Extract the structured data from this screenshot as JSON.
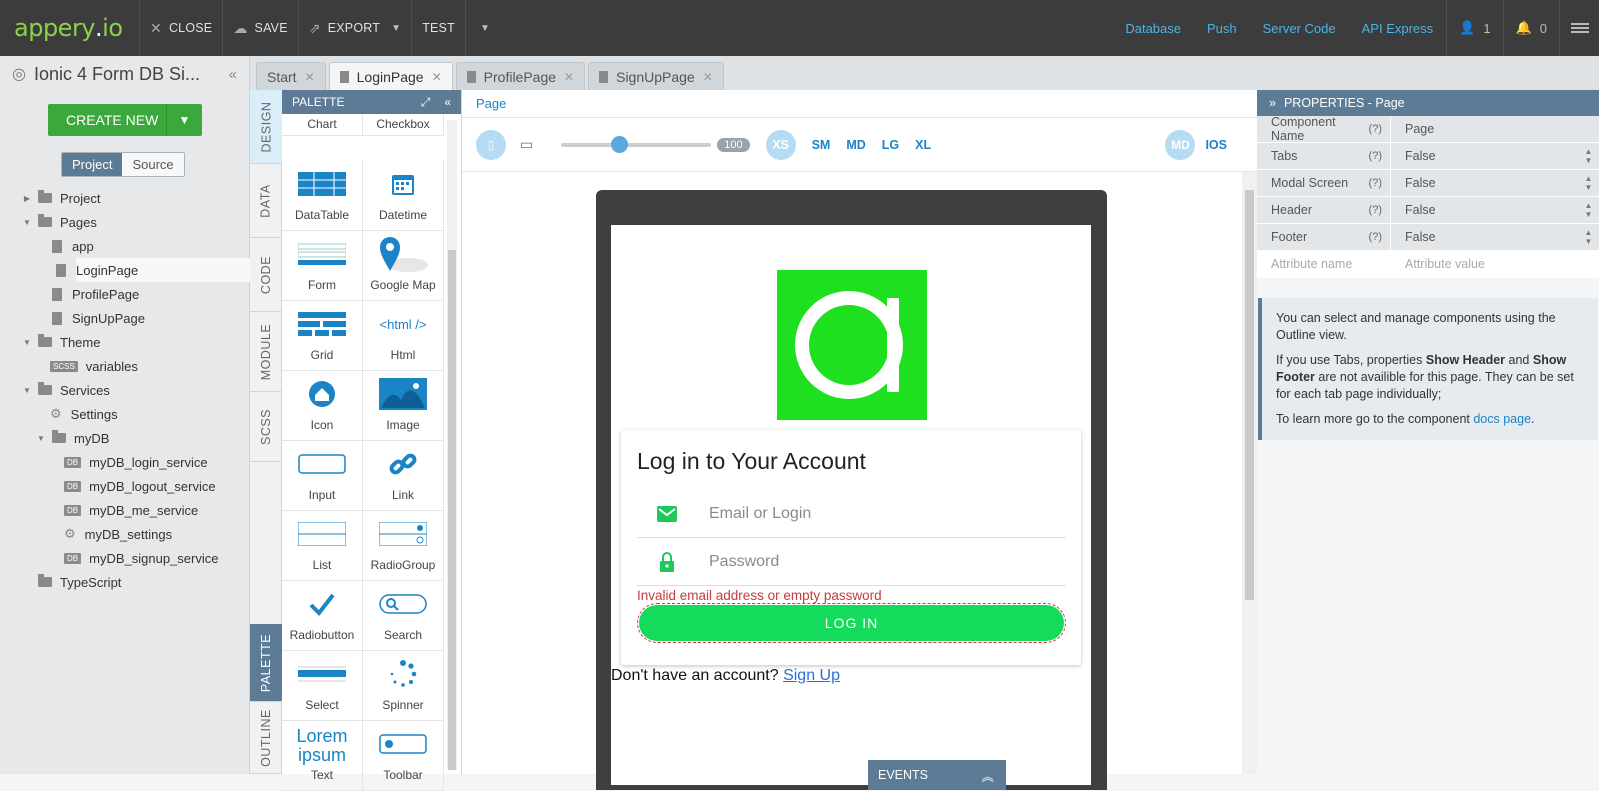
{
  "topbar": {
    "logo_main": "appery",
    "logo_dot": ".",
    "logo_io": "io",
    "buttons": [
      {
        "label": "CLOSE",
        "icon": "close-icon"
      },
      {
        "label": "SAVE",
        "icon": "cloud-upload-icon"
      },
      {
        "label": "EXPORT",
        "icon": "export-icon"
      },
      {
        "label": "TEST",
        "icon": "none"
      }
    ],
    "links": [
      "Database",
      "Push",
      "Server Code",
      "API Express"
    ],
    "user_count": "1",
    "notif_count": "0"
  },
  "left": {
    "project_title": "Ionic 4 Form DB Si...",
    "create_new": "CREATE NEW",
    "seg_project": "Project",
    "seg_source": "Source",
    "tree": [
      {
        "label": "Project",
        "type": "folder",
        "indent": 0,
        "twisty": "▶"
      },
      {
        "label": "Pages",
        "type": "folder",
        "indent": 0,
        "twisty": "▼"
      },
      {
        "label": "app",
        "type": "file",
        "indent": 1
      },
      {
        "label": "LoginPage",
        "type": "file",
        "indent": 1,
        "selected": true
      },
      {
        "label": "ProfilePage",
        "type": "file",
        "indent": 1
      },
      {
        "label": "SignUpPage",
        "type": "file",
        "indent": 1
      },
      {
        "label": "Theme",
        "type": "folder",
        "indent": 0,
        "twisty": "▼"
      },
      {
        "label": "variables",
        "type": "scss",
        "indent": 1,
        "tag": "SCSS"
      },
      {
        "label": "Services",
        "type": "folder",
        "indent": 0,
        "twisty": "▼"
      },
      {
        "label": "Settings",
        "type": "gear",
        "indent": 1
      },
      {
        "label": "myDB",
        "type": "folder",
        "indent": 1,
        "twisty": "▼"
      },
      {
        "label": "myDB_login_service",
        "type": "db",
        "indent": 2,
        "tag": "DB"
      },
      {
        "label": "myDB_logout_service",
        "type": "db",
        "indent": 2,
        "tag": "DB"
      },
      {
        "label": "myDB_me_service",
        "type": "db",
        "indent": 2,
        "tag": "DB"
      },
      {
        "label": "myDB_settings",
        "type": "gear",
        "indent": 2
      },
      {
        "label": "myDB_signup_service",
        "type": "db",
        "indent": 2,
        "tag": "DB"
      },
      {
        "label": "TypeScript",
        "type": "folder",
        "indent": 0
      }
    ]
  },
  "tabs": [
    {
      "label": "Start",
      "active": false,
      "doc": false
    },
    {
      "label": "LoginPage",
      "active": true,
      "doc": true
    },
    {
      "label": "ProfilePage",
      "active": false,
      "doc": true
    },
    {
      "label": "SignUpPage",
      "active": false,
      "doc": true
    }
  ],
  "vtabs": {
    "design": "DESIGN",
    "data": "DATA",
    "code": "CODE",
    "module": "MODULE",
    "scss": "SCSS",
    "palette": "PALETTE",
    "outline": "OUTLINE"
  },
  "palette": {
    "title": "PALETTE",
    "items": [
      "Chart",
      "Checkbox",
      "DataTable",
      "Datetime",
      "Form",
      "Google Map",
      "Grid",
      "Html",
      "Icon",
      "Image",
      "Input",
      "Link",
      "List",
      "RadioGroup",
      "Radiobutton",
      "Search",
      "Select",
      "Spinner",
      "Text",
      "Toolbar"
    ],
    "html_icon_text": "<html />",
    "lorem_line1": "Lorem",
    "lorem_line2": "ipsum"
  },
  "canvas": {
    "breadcrumb": "Page",
    "slider_value": "100",
    "breakpoints": [
      "XS",
      "SM",
      "MD",
      "LG",
      "XL"
    ],
    "platform_md": "MD",
    "platform_ios": "IOS",
    "login_title": "Log in to Your Account",
    "email_placeholder": "Email or Login",
    "password_placeholder": "Password",
    "error_text": "Invalid email address or empty password",
    "login_button": "LOG IN",
    "signup_text": "Don't have an account?",
    "signup_link": "Sign Up",
    "events_label": "EVENTS",
    "accent_green": "#14db5c",
    "logo_green": "#1ee01e"
  },
  "properties": {
    "title": "PROPERTIES - Page",
    "rows": [
      {
        "key": "Component Name",
        "value": "Page",
        "select": false
      },
      {
        "key": "Tabs",
        "value": "False",
        "select": true
      },
      {
        "key": "Modal Screen",
        "value": "False",
        "select": true
      },
      {
        "key": "Header",
        "value": "False",
        "select": true
      },
      {
        "key": "Footer",
        "value": "False",
        "select": true
      }
    ],
    "attr_name_placeholder": "Attribute name",
    "attr_value_placeholder": "Attribute value",
    "info1": "You can select and manage components using the Outline view.",
    "info2_a": "If you use Tabs, properties ",
    "info2_b": "Show Header",
    "info2_c": " and ",
    "info2_d": "Show Footer",
    "info2_e": " are not availible for this page. They can be set for each tab page individually;",
    "info3_a": "To learn more go to the component ",
    "info3_link": "docs page",
    "info3_b": "."
  }
}
